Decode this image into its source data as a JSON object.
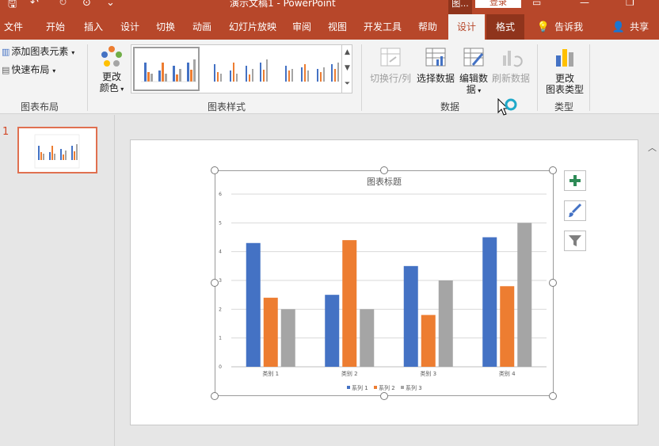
{
  "titlebar": {
    "title": "演示文稿1 - PowerPoint",
    "context_group": "图...",
    "login": "登录"
  },
  "tabs": [
    {
      "label": "文件"
    },
    {
      "label": "开始"
    },
    {
      "label": "插入"
    },
    {
      "label": "设计"
    },
    {
      "label": "切换"
    },
    {
      "label": "动画"
    },
    {
      "label": "幻灯片放映"
    },
    {
      "label": "审阅"
    },
    {
      "label": "视图"
    },
    {
      "label": "开发工具"
    },
    {
      "label": "帮助"
    },
    {
      "label": "设计"
    },
    {
      "label": "格式"
    }
  ],
  "tell_me": "告诉我",
  "share": "共享",
  "ribbon": {
    "add_element": "添加图表元素",
    "quick_layout": "快速布局",
    "layout_group": "图表布局",
    "change_color_1": "更改",
    "change_color_2": "颜色",
    "styles_group": "图表样式",
    "switch_rowcol": "切换行/列",
    "select_data": "选择数据",
    "edit_data_1": "编辑数",
    "edit_data_2": "据",
    "refresh_data": "刷新数据",
    "data_group": "数据",
    "change_type_1": "更改",
    "change_type_2": "图表类型",
    "type_group": "类型"
  },
  "slides": [
    {
      "number": "1"
    }
  ],
  "colors": {
    "brand": "#b7472a",
    "series1": "#4472c4",
    "series2": "#ed7d31",
    "series3": "#a5a5a5"
  },
  "chart_data": {
    "type": "bar",
    "title": "图表标题",
    "categories": [
      "类别 1",
      "类别 2",
      "类别 3",
      "类别 4"
    ],
    "series": [
      {
        "name": "系列 1",
        "values": [
          4.3,
          2.5,
          3.5,
          4.5
        ]
      },
      {
        "name": "系列 2",
        "values": [
          2.4,
          4.4,
          1.8,
          2.8
        ]
      },
      {
        "name": "系列 3",
        "values": [
          2,
          2,
          3,
          5
        ]
      }
    ],
    "yticks": [
      "0",
      "1",
      "2",
      "3",
      "4",
      "5",
      "6"
    ],
    "ylim": [
      0,
      6
    ],
    "grid": true,
    "legend": "bottom"
  }
}
